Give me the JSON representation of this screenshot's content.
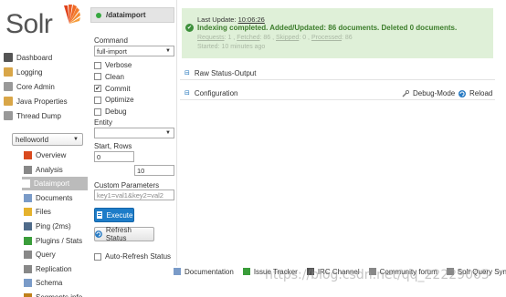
{
  "logo": {
    "text": "Solr"
  },
  "nav": [
    {
      "label": "Dashboard",
      "icon": "dashboard-icon",
      "color": "#555555"
    },
    {
      "label": "Logging",
      "icon": "logging-icon",
      "color": "#d9a648"
    },
    {
      "label": "Core Admin",
      "icon": "core-admin-icon",
      "color": "#999999"
    },
    {
      "label": "Java Properties",
      "icon": "java-icon",
      "color": "#d9a648"
    },
    {
      "label": "Thread Dump",
      "icon": "thread-dump-icon",
      "color": "#999999"
    }
  ],
  "core_selector": {
    "value": "helloworld"
  },
  "core_menu": [
    {
      "label": "Overview",
      "icon": "overview-icon",
      "color": "#d94a1e"
    },
    {
      "label": "Analysis",
      "icon": "analysis-icon",
      "color": "#888888"
    },
    {
      "label": "Dataimport",
      "icon": "dataimport-icon",
      "color": "#ffffff",
      "active": true
    },
    {
      "label": "Documents",
      "icon": "documents-icon",
      "color": "#7a9bc8"
    },
    {
      "label": "Files",
      "icon": "files-icon",
      "color": "#e5b22d"
    },
    {
      "label": "Ping (2ms)",
      "icon": "ping-icon",
      "color": "#4f6b8a"
    },
    {
      "label": "Plugins / Stats",
      "icon": "plugins-icon",
      "color": "#3a9d3a"
    },
    {
      "label": "Query",
      "icon": "query-icon",
      "color": "#888888"
    },
    {
      "label": "Replication",
      "icon": "replication-icon",
      "color": "#888888"
    },
    {
      "label": "Schema",
      "icon": "schema-icon",
      "color": "#7a9bc8"
    },
    {
      "label": "Segments info",
      "icon": "segments-icon",
      "color": "#c0801a"
    }
  ],
  "dataimport": {
    "handler": "/dataimport",
    "command_label": "Command",
    "command_value": "full-import",
    "options": [
      {
        "label": "Verbose",
        "checked": false
      },
      {
        "label": "Clean",
        "checked": false
      },
      {
        "label": "Commit",
        "checked": true
      },
      {
        "label": "Optimize",
        "checked": false
      },
      {
        "label": "Debug",
        "checked": false
      }
    ],
    "entity_label": "Entity",
    "entity_value": "",
    "start_rows_label": "Start, Rows",
    "start_value": "0",
    "rows_value": "10",
    "custom_params_label": "Custom Parameters",
    "custom_params_placeholder": "key1=val1&key2=val2",
    "execute_label": "Execute",
    "refresh_label": "Refresh Status",
    "auto_refresh_label": "Auto-Refresh Status"
  },
  "status": {
    "last_update_prefix": "Last Update: ",
    "last_update_time": "10:06:26",
    "message": "Indexing completed. Added/Updated: 86 documents. Deleted 0 documents.",
    "requests_label": "Requests",
    "requests_value": ": 1 , ",
    "fetched_label": "Fetched",
    "fetched_value": ": 86 , ",
    "skipped_label": "Skipped",
    "skipped_value": ": 0 , ",
    "processed_label": "Processed",
    "processed_value": ": 86",
    "started": "Started: 10 minutes ago"
  },
  "sections": {
    "raw_status": "Raw Status-Output",
    "configuration": "Configuration",
    "debug_mode": "Debug-Mode",
    "reload": "Reload",
    "toggle_glyph": "⊟"
  },
  "footer": {
    "items": [
      "Documentation",
      "Issue Tracker",
      "IRC Channel",
      "Community forum",
      "Solr Query Syntax"
    ]
  },
  "watermark": "https://blog.csdn.net/qq_22229005"
}
